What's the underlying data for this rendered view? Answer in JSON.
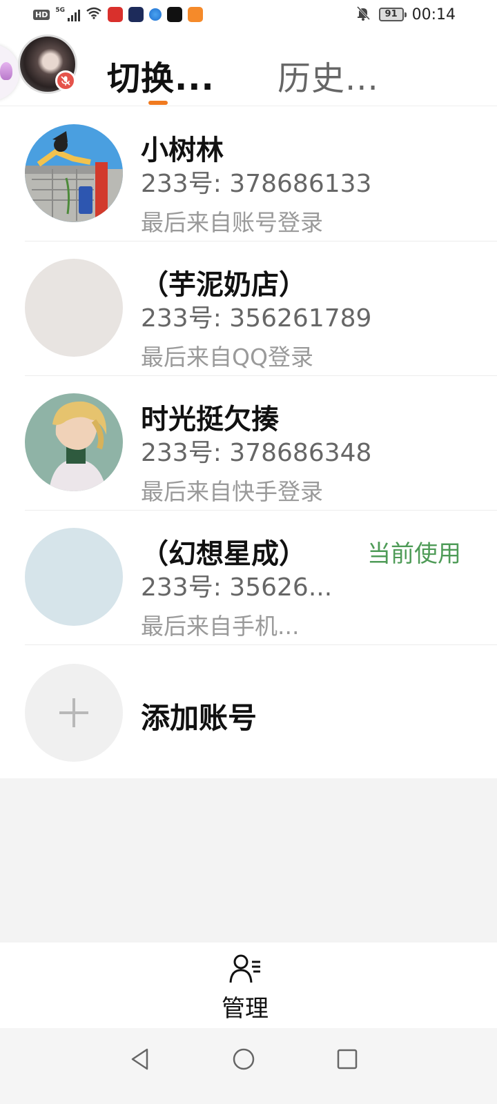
{
  "status_bar": {
    "hd": "HD",
    "network": "5G",
    "battery": "91",
    "time": "00:14"
  },
  "header": {
    "tab_switch": "切换...",
    "tab_history": "历史..."
  },
  "accounts": [
    {
      "name": "小树林",
      "uid_label": "233号: ",
      "uid": "378686133",
      "last_login": "最后来自账号登录",
      "current": ""
    },
    {
      "name": "（芋泥奶店）",
      "uid_label": "233号: ",
      "uid": "356261789",
      "last_login": "最后来自QQ登录",
      "current": ""
    },
    {
      "name": "时光挺欠揍",
      "uid_label": "233号: ",
      "uid": "378686348",
      "last_login": "最后来自快手登录",
      "current": ""
    },
    {
      "name": "（幻想星成）",
      "uid_label": "233号: ",
      "uid": "35626...",
      "last_login": "最后来自手机...",
      "current": "当前使用"
    }
  ],
  "add_account": "添加账号",
  "manage": "管理",
  "colors": {
    "accent_orange": "#f07a1f",
    "current_green": "#4e9b57"
  }
}
